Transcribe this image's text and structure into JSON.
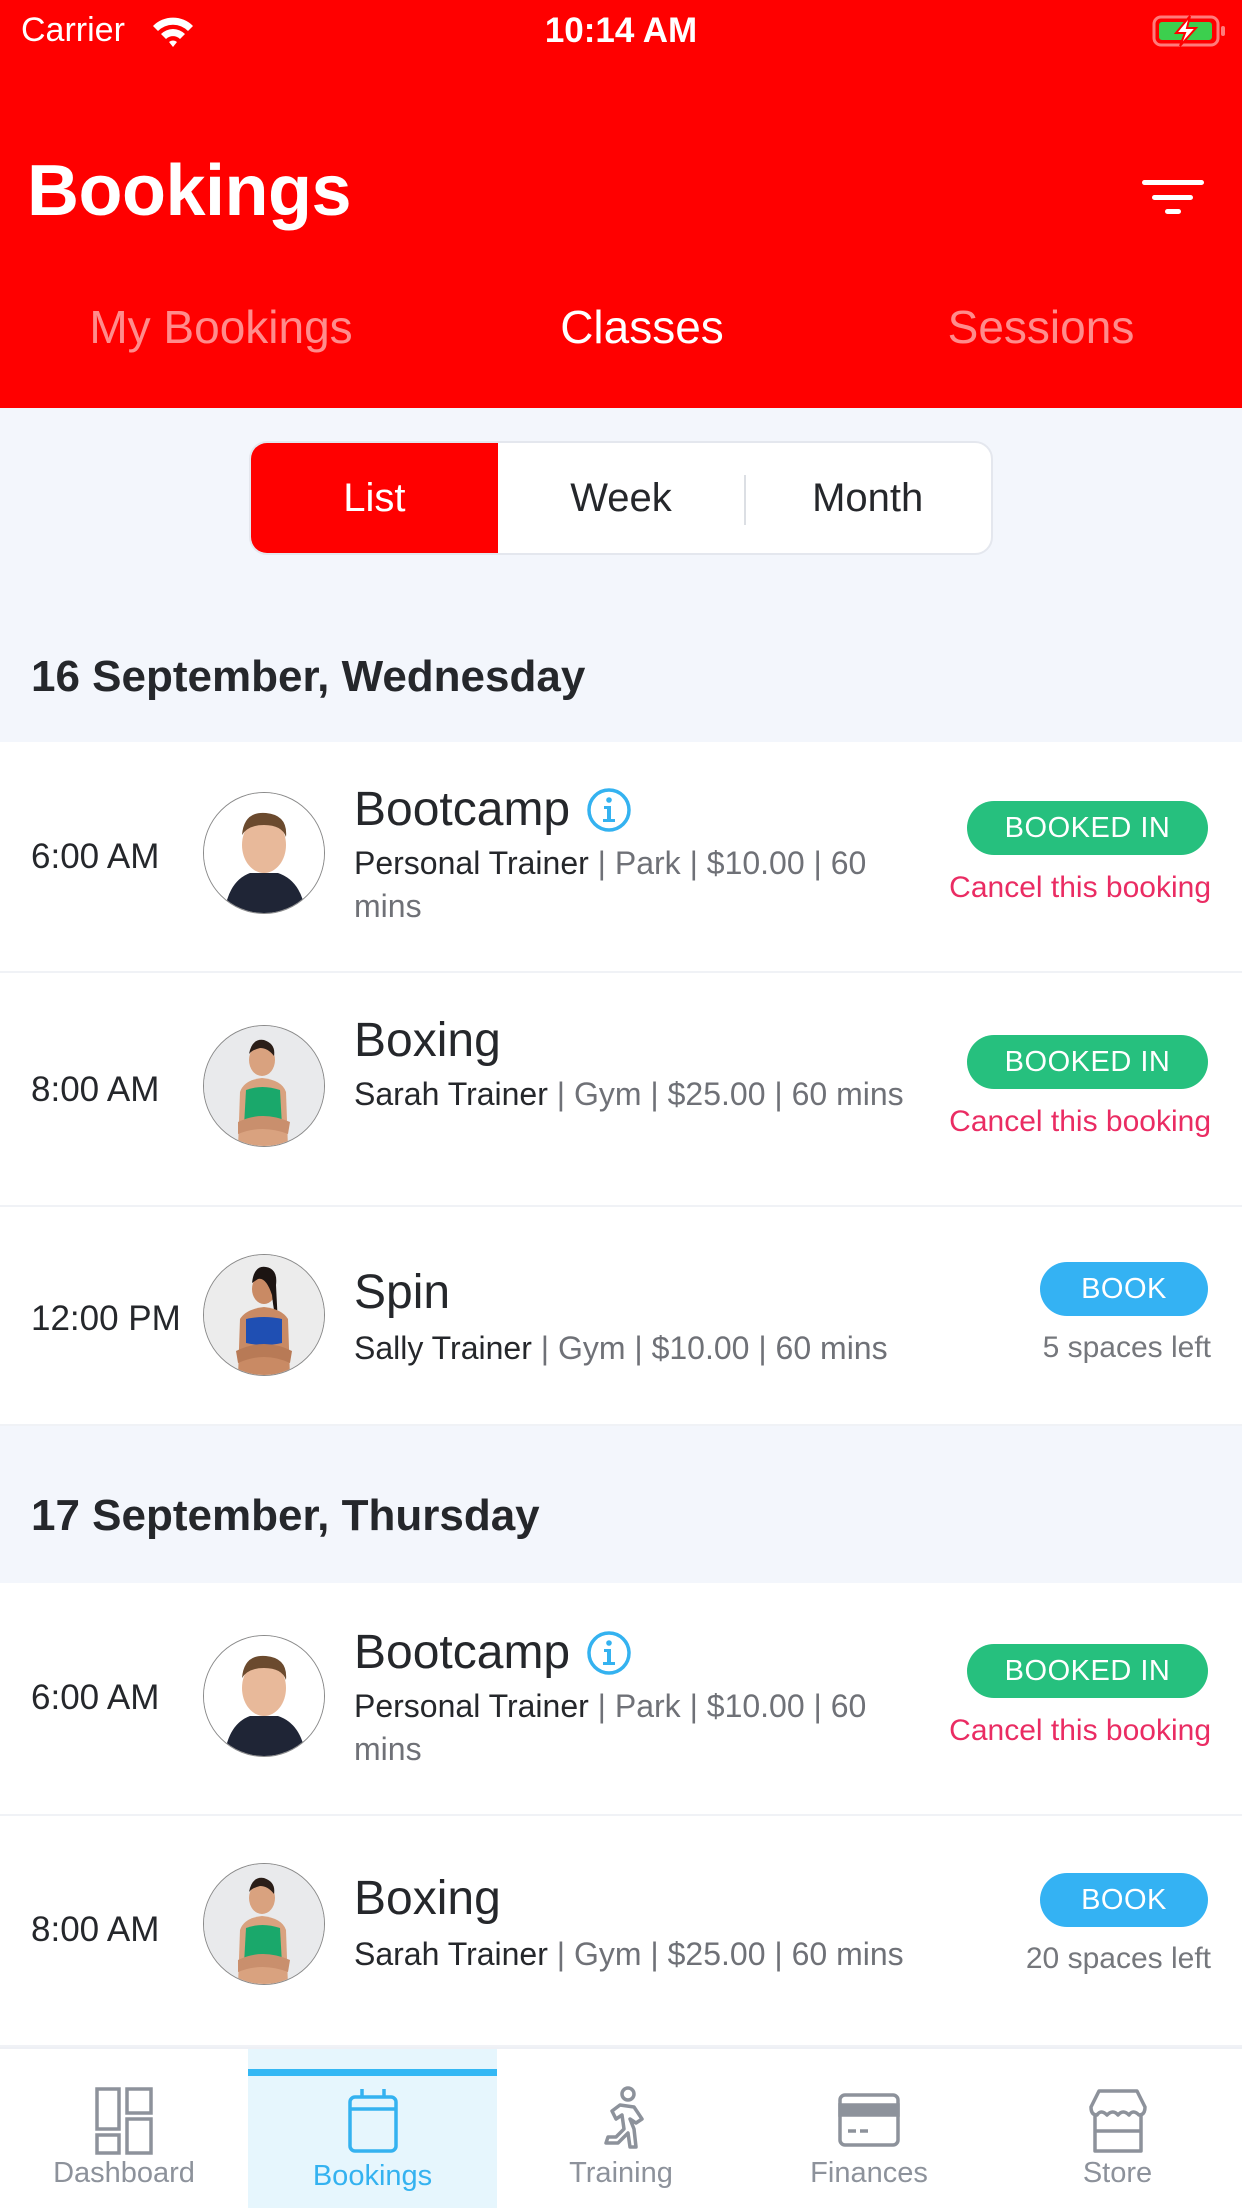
{
  "status_bar": {
    "carrier": "Carrier",
    "time": "10:14 AM",
    "battery": "charging"
  },
  "header": {
    "title": "Bookings",
    "filter_icon": "filter-icon",
    "tabs": [
      {
        "label": "My Bookings",
        "active": false
      },
      {
        "label": "Classes",
        "active": true
      },
      {
        "label": "Sessions",
        "active": false
      }
    ]
  },
  "view_toggle": {
    "options": [
      {
        "label": "List",
        "active": true
      },
      {
        "label": "Week",
        "active": false
      },
      {
        "label": "Month",
        "active": false
      }
    ]
  },
  "days": [
    {
      "date": "16 September, Wednesday",
      "classes": [
        {
          "time": "6:00 AM",
          "title": "Bootcamp",
          "has_info": true,
          "trainer": "Personal Trainer",
          "details": " | Park | $10.00 | 60 mins",
          "status": "BOOKED IN",
          "action": "Cancel this booking",
          "avatar": "male-trainer"
        },
        {
          "time": "8:00 AM",
          "title": "Boxing",
          "has_info": false,
          "trainer": "Sarah Trainer",
          "details": " | Gym | $25.00 | 60 mins",
          "status": "BOOKED IN",
          "action": "Cancel this booking",
          "avatar": "female-trainer-green"
        },
        {
          "time": "12:00 PM",
          "title": "Spin",
          "has_info": false,
          "trainer": "Sally Trainer",
          "details": " | Gym | $10.00 | 60 mins",
          "status": "BOOK",
          "action": "5 spaces left",
          "avatar": "female-trainer-blue"
        }
      ]
    },
    {
      "date": "17 September, Thursday",
      "classes": [
        {
          "time": "6:00 AM",
          "title": "Bootcamp",
          "has_info": true,
          "trainer": "Personal Trainer",
          "details": " | Park | $10.00 | 60 mins",
          "status": "BOOKED IN",
          "action": "Cancel this booking",
          "avatar": "male-trainer"
        },
        {
          "time": "8:00 AM",
          "title": "Boxing",
          "has_info": false,
          "trainer": "Sarah Trainer",
          "details": " | Gym | $25.00 | 60 mins",
          "status": "BOOK",
          "action": "20 spaces left",
          "avatar": "female-trainer-green"
        }
      ]
    }
  ],
  "tab_bar": {
    "items": [
      {
        "label": "Dashboard",
        "icon": "dashboard-icon",
        "active": false
      },
      {
        "label": "Bookings",
        "icon": "calendar-icon",
        "active": true
      },
      {
        "label": "Training",
        "icon": "running-icon",
        "active": false
      },
      {
        "label": "Finances",
        "icon": "credit-card-icon",
        "active": false
      },
      {
        "label": "Store",
        "icon": "store-icon",
        "active": false
      }
    ]
  },
  "colors": {
    "brand_red": "#ff0000",
    "booked_green": "#26c07e",
    "book_blue": "#34b2f3",
    "cancel_pink": "#ea2c63",
    "active_tab_blue": "#34b8f4"
  }
}
